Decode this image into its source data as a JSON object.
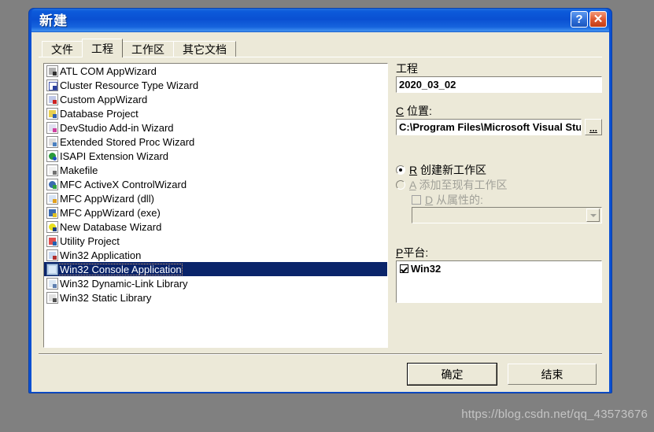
{
  "window": {
    "title": "新建",
    "help_button": "?",
    "close_button": "✕"
  },
  "tabs": [
    {
      "label": "文件",
      "active": false
    },
    {
      "label": "工程",
      "active": true
    },
    {
      "label": "工作区",
      "active": false
    },
    {
      "label": "其它文档",
      "active": false
    }
  ],
  "project_list": {
    "items": [
      {
        "label": "ATL COM AppWizard",
        "icon": "atl-com-appwizard-icon",
        "icon_class": "ico-a",
        "selected": false
      },
      {
        "label": "Cluster Resource Type Wizard",
        "icon": "cluster-resource-type-wizard-icon",
        "icon_class": "ico-b",
        "selected": false
      },
      {
        "label": "Custom AppWizard",
        "icon": "custom-appwizard-icon",
        "icon_class": "ico-c",
        "selected": false
      },
      {
        "label": "Database Project",
        "icon": "database-project-icon",
        "icon_class": "ico-d",
        "selected": false
      },
      {
        "label": "DevStudio Add-in Wizard",
        "icon": "devstudio-addin-wizard-icon",
        "icon_class": "ico-e",
        "selected": false
      },
      {
        "label": "Extended Stored Proc Wizard",
        "icon": "extended-stored-proc-wizard-icon",
        "icon_class": "ico-f",
        "selected": false
      },
      {
        "label": "ISAPI Extension Wizard",
        "icon": "isapi-extension-wizard-icon",
        "icon_class": "ico-g",
        "selected": false
      },
      {
        "label": "Makefile",
        "icon": "makefile-icon",
        "icon_class": "ico-h",
        "selected": false
      },
      {
        "label": "MFC ActiveX ControlWizard",
        "icon": "mfc-activex-controlwizard-icon",
        "icon_class": "ico-i",
        "selected": false
      },
      {
        "label": "MFC AppWizard (dll)",
        "icon": "mfc-appwizard-dll-icon",
        "icon_class": "ico-j",
        "selected": false
      },
      {
        "label": "MFC AppWizard (exe)",
        "icon": "mfc-appwizard-exe-icon",
        "icon_class": "ico-k",
        "selected": false
      },
      {
        "label": "New Database Wizard",
        "icon": "new-database-wizard-icon",
        "icon_class": "ico-l",
        "selected": false
      },
      {
        "label": "Utility Project",
        "icon": "utility-project-icon",
        "icon_class": "ico-m",
        "selected": false
      },
      {
        "label": "Win32 Application",
        "icon": "win32-application-icon",
        "icon_class": "ico-n",
        "selected": false
      },
      {
        "label": "Win32 Console Application",
        "icon": "win32-console-application-icon",
        "icon_class": "ico-o",
        "selected": true
      },
      {
        "label": "Win32 Dynamic-Link Library",
        "icon": "win32-dynamic-link-library-icon",
        "icon_class": "ico-p",
        "selected": false
      },
      {
        "label": "Win32 Static Library",
        "icon": "win32-static-library-icon",
        "icon_class": "ico-q",
        "selected": false
      }
    ]
  },
  "right_panel": {
    "project_label": "工程",
    "project_name_value": "2020_03_02",
    "location_accel": "C",
    "location_label": "位置:",
    "location_value": "C:\\Program Files\\Microsoft Visual Studio\\MyProjects",
    "browse_button": "...",
    "create_new_workspace": {
      "accel": "R",
      "label": "创建新工作区",
      "checked": true,
      "enabled": true
    },
    "add_to_existing_workspace": {
      "accel": "A",
      "label": "添加至现有工作区",
      "checked": false,
      "enabled": false
    },
    "dependency_checkbox": {
      "accel": "D",
      "label": "从属性的:",
      "checked": false,
      "enabled": false
    },
    "dependency_combo_value": "",
    "platform_accel": "P",
    "platform_label": "平台:",
    "platforms": [
      {
        "label": "Win32",
        "checked": true
      }
    ]
  },
  "footer": {
    "ok_button": "确定",
    "cancel_button": "结束"
  },
  "watermark": "https://blog.csdn.net/qq_43573676",
  "colors": {
    "titlebar_blue": "#0a50d2",
    "dialog_face": "#ece9d8",
    "selection_blue": "#0a246a",
    "close_red": "#e05a32"
  }
}
